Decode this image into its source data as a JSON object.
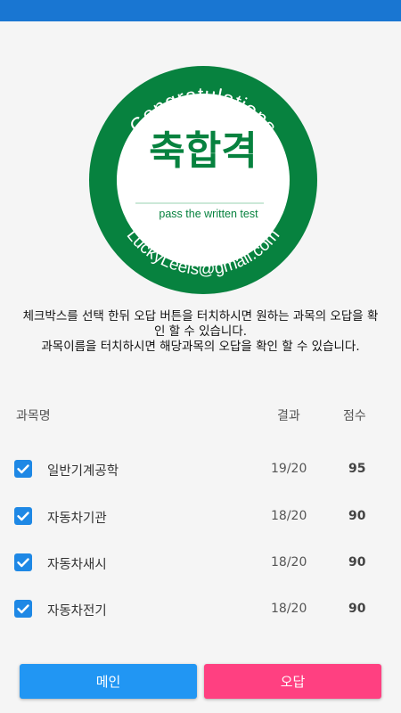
{
  "seal": {
    "top_text": "Congratulations",
    "center_text": "축합격",
    "sub_text": "pass the written test",
    "bottom_text": "LuckyLeeis@gmail.com",
    "colors": {
      "ring": "#07823f",
      "inner": "#ffffff"
    }
  },
  "instructions": {
    "line1": "체크박스를 선택 한뒤 오답 버튼을 터치하시면 원하는 과목의 오답을 확인 할 수 있습니다.",
    "line2": "과목이름을 터치하시면 해당과목의 오답을 확인 할 수 있습니다."
  },
  "table": {
    "headers": {
      "subject": "과목명",
      "result": "결과",
      "score": "점수"
    },
    "rows": [
      {
        "subject": "일반기계공학",
        "result": "19/20",
        "score": "95",
        "checked": true
      },
      {
        "subject": "자동차기관",
        "result": "18/20",
        "score": "90",
        "checked": true
      },
      {
        "subject": "자동차새시",
        "result": "18/20",
        "score": "90",
        "checked": true
      },
      {
        "subject": "자동차전기",
        "result": "18/20",
        "score": "90",
        "checked": true
      }
    ]
  },
  "buttons": {
    "main": "메인",
    "wrong_answers": "오답"
  },
  "colors": {
    "status_bar": "#1976d2",
    "primary": "#2196f3",
    "accent": "#ff4081",
    "checkbox": "#1e88e5"
  }
}
